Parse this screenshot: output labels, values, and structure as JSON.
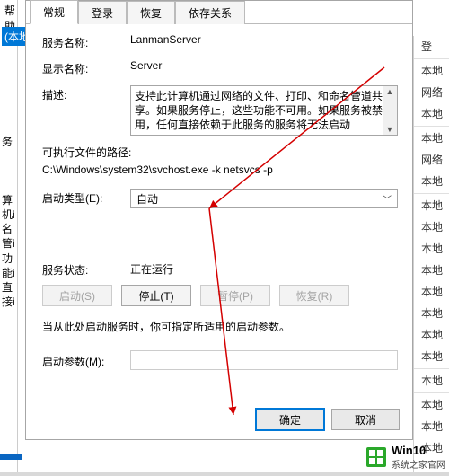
{
  "menu_frag": "帮助(H)",
  "left_selected": "(本地",
  "left_text": "务\n\n\n\n算机i\n名管i\n功能i\n直接i",
  "dialog": {
    "tabs": [
      "常规",
      "登录",
      "恢复",
      "依存关系"
    ],
    "active_tab": 0,
    "service_name": {
      "label": "服务名称:",
      "value": "LanmanServer"
    },
    "display_name": {
      "label": "显示名称:",
      "value": "Server"
    },
    "description": {
      "label": "描述:",
      "value": "支持此计算机通过网络的文件、打印、和命名管道共享。如果服务停止，这些功能不可用。如果服务被禁用，任何直接依赖于此服务的服务将无法启动"
    },
    "exe_path": {
      "label": "可执行文件的路径:",
      "value": "C:\\Windows\\system32\\svchost.exe -k netsvcs -p"
    },
    "startup": {
      "label": "启动类型(E):",
      "value": "自动"
    },
    "status": {
      "label": "服务状态:",
      "value": "正在运行"
    },
    "buttons": {
      "start": "启动(S)",
      "stop": "停止(T)",
      "pause": "暂停(P)",
      "resume": "恢复(R)"
    },
    "hint": "当从此处启动服务时，你可指定所适用的启动参数。",
    "params_label": "启动参数(M):",
    "ok": "确定",
    "cancel": "取消"
  },
  "bg_rows": [
    "登",
    "",
    "本地",
    "网络",
    "本地",
    "",
    "本地",
    "网络",
    "本地",
    "",
    "本地",
    "本地",
    "本地",
    "本地",
    "本地",
    "本地",
    "本地",
    "本地",
    "",
    "本地",
    "",
    "本地",
    "本地",
    "本地"
  ],
  "watermark": {
    "t1": "Win10",
    "t2": "系统之家官网"
  }
}
